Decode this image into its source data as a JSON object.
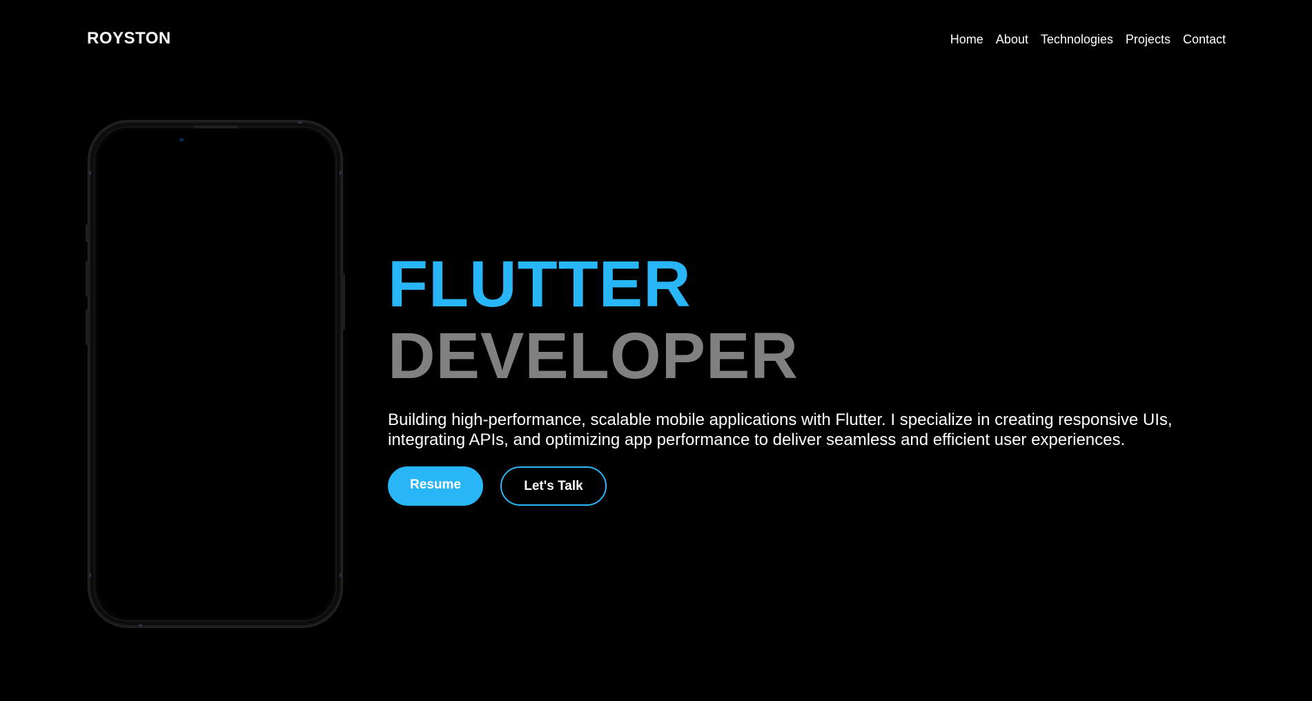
{
  "header": {
    "logo": "ROYSTON",
    "nav": [
      {
        "label": "Home"
      },
      {
        "label": "About"
      },
      {
        "label": "Technologies"
      },
      {
        "label": "Projects"
      },
      {
        "label": "Contact"
      }
    ]
  },
  "hero": {
    "title_line_1": "FLUTTER",
    "title_line_2": "DEVELOPER",
    "description": "Building high-performance, scalable mobile applications with Flutter. I specialize in creating responsive UIs, integrating APIs, and optimizing app performance to deliver seamless and efficient user experiences.",
    "primary_button": "Resume",
    "secondary_button": "Let's Talk"
  },
  "colors": {
    "background": "#000000",
    "accent": "#29b6f6",
    "muted": "#808080",
    "text": "#ffffff"
  },
  "icons": {
    "phone_mockup": "phone-mockup-icon"
  }
}
